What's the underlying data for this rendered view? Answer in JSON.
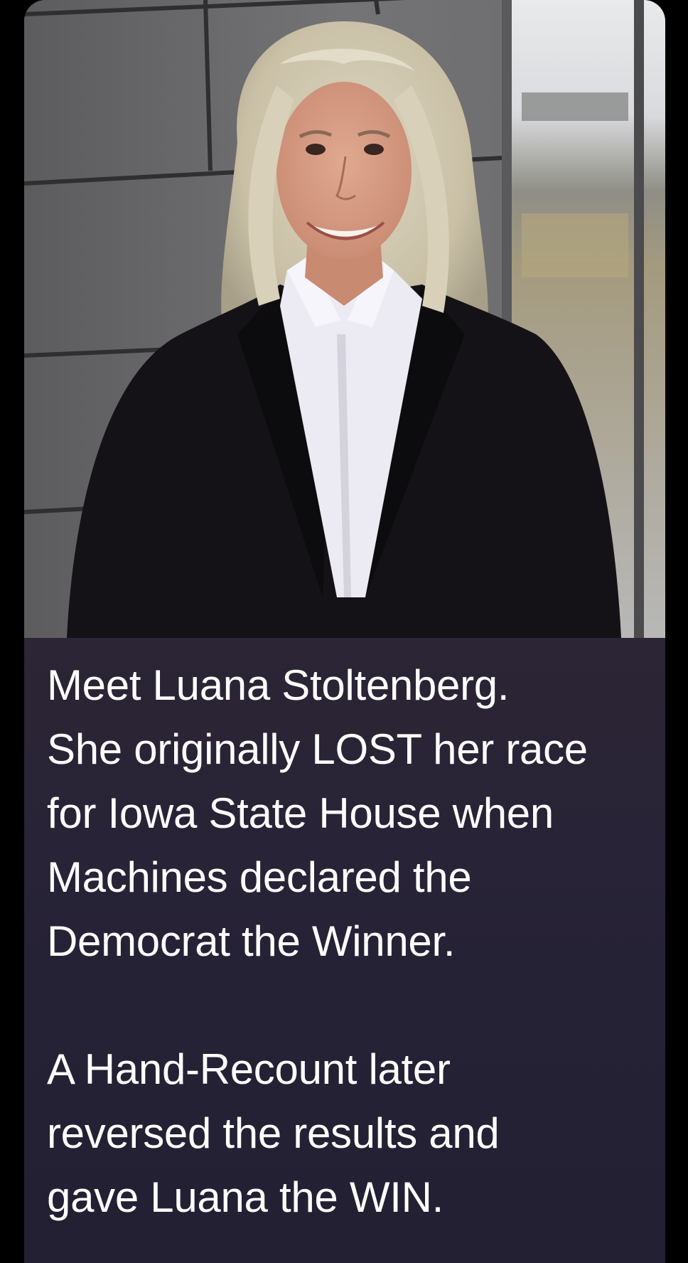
{
  "post": {
    "image": {
      "icon": "portrait-photo"
    },
    "caption": {
      "paragraphs": [
        {
          "lines": [
            "Meet Luana Stoltenberg.",
            "She originally LOST her race",
            "for Iowa State House when",
            "Machines declared the",
            "Democrat the Winner."
          ]
        },
        {
          "lines": [
            "A Hand-Recount later",
            "reversed the results and",
            "gave Luana the WIN."
          ]
        }
      ]
    }
  },
  "colors": {
    "page_background": "#000000",
    "caption_background": "#262236",
    "caption_text": "#ffffff"
  }
}
